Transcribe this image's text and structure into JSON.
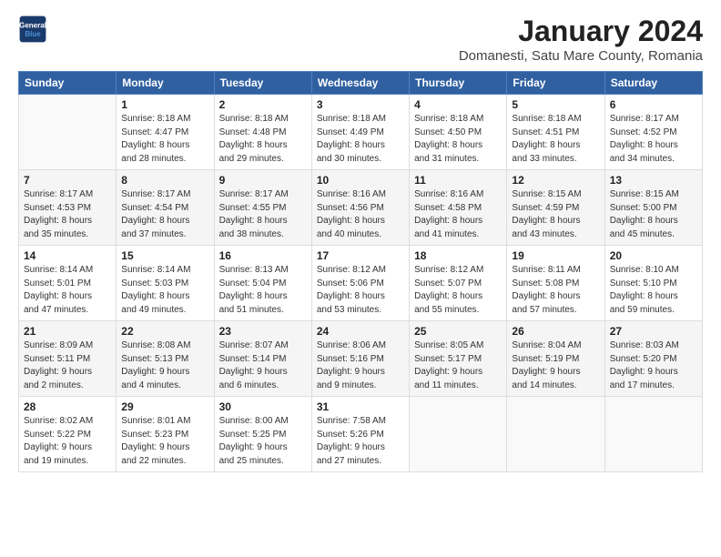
{
  "logo": {
    "line1": "General",
    "line2": "Blue"
  },
  "title": "January 2024",
  "subtitle": "Domanesti, Satu Mare County, Romania",
  "days_of_week": [
    "Sunday",
    "Monday",
    "Tuesday",
    "Wednesday",
    "Thursday",
    "Friday",
    "Saturday"
  ],
  "weeks": [
    [
      {
        "day": "",
        "info": ""
      },
      {
        "day": "1",
        "info": "Sunrise: 8:18 AM\nSunset: 4:47 PM\nDaylight: 8 hours\nand 28 minutes."
      },
      {
        "day": "2",
        "info": "Sunrise: 8:18 AM\nSunset: 4:48 PM\nDaylight: 8 hours\nand 29 minutes."
      },
      {
        "day": "3",
        "info": "Sunrise: 8:18 AM\nSunset: 4:49 PM\nDaylight: 8 hours\nand 30 minutes."
      },
      {
        "day": "4",
        "info": "Sunrise: 8:18 AM\nSunset: 4:50 PM\nDaylight: 8 hours\nand 31 minutes."
      },
      {
        "day": "5",
        "info": "Sunrise: 8:18 AM\nSunset: 4:51 PM\nDaylight: 8 hours\nand 33 minutes."
      },
      {
        "day": "6",
        "info": "Sunrise: 8:17 AM\nSunset: 4:52 PM\nDaylight: 8 hours\nand 34 minutes."
      }
    ],
    [
      {
        "day": "7",
        "info": "Sunrise: 8:17 AM\nSunset: 4:53 PM\nDaylight: 8 hours\nand 35 minutes."
      },
      {
        "day": "8",
        "info": "Sunrise: 8:17 AM\nSunset: 4:54 PM\nDaylight: 8 hours\nand 37 minutes."
      },
      {
        "day": "9",
        "info": "Sunrise: 8:17 AM\nSunset: 4:55 PM\nDaylight: 8 hours\nand 38 minutes."
      },
      {
        "day": "10",
        "info": "Sunrise: 8:16 AM\nSunset: 4:56 PM\nDaylight: 8 hours\nand 40 minutes."
      },
      {
        "day": "11",
        "info": "Sunrise: 8:16 AM\nSunset: 4:58 PM\nDaylight: 8 hours\nand 41 minutes."
      },
      {
        "day": "12",
        "info": "Sunrise: 8:15 AM\nSunset: 4:59 PM\nDaylight: 8 hours\nand 43 minutes."
      },
      {
        "day": "13",
        "info": "Sunrise: 8:15 AM\nSunset: 5:00 PM\nDaylight: 8 hours\nand 45 minutes."
      }
    ],
    [
      {
        "day": "14",
        "info": "Sunrise: 8:14 AM\nSunset: 5:01 PM\nDaylight: 8 hours\nand 47 minutes."
      },
      {
        "day": "15",
        "info": "Sunrise: 8:14 AM\nSunset: 5:03 PM\nDaylight: 8 hours\nand 49 minutes."
      },
      {
        "day": "16",
        "info": "Sunrise: 8:13 AM\nSunset: 5:04 PM\nDaylight: 8 hours\nand 51 minutes."
      },
      {
        "day": "17",
        "info": "Sunrise: 8:12 AM\nSunset: 5:06 PM\nDaylight: 8 hours\nand 53 minutes."
      },
      {
        "day": "18",
        "info": "Sunrise: 8:12 AM\nSunset: 5:07 PM\nDaylight: 8 hours\nand 55 minutes."
      },
      {
        "day": "19",
        "info": "Sunrise: 8:11 AM\nSunset: 5:08 PM\nDaylight: 8 hours\nand 57 minutes."
      },
      {
        "day": "20",
        "info": "Sunrise: 8:10 AM\nSunset: 5:10 PM\nDaylight: 8 hours\nand 59 minutes."
      }
    ],
    [
      {
        "day": "21",
        "info": "Sunrise: 8:09 AM\nSunset: 5:11 PM\nDaylight: 9 hours\nand 2 minutes."
      },
      {
        "day": "22",
        "info": "Sunrise: 8:08 AM\nSunset: 5:13 PM\nDaylight: 9 hours\nand 4 minutes."
      },
      {
        "day": "23",
        "info": "Sunrise: 8:07 AM\nSunset: 5:14 PM\nDaylight: 9 hours\nand 6 minutes."
      },
      {
        "day": "24",
        "info": "Sunrise: 8:06 AM\nSunset: 5:16 PM\nDaylight: 9 hours\nand 9 minutes."
      },
      {
        "day": "25",
        "info": "Sunrise: 8:05 AM\nSunset: 5:17 PM\nDaylight: 9 hours\nand 11 minutes."
      },
      {
        "day": "26",
        "info": "Sunrise: 8:04 AM\nSunset: 5:19 PM\nDaylight: 9 hours\nand 14 minutes."
      },
      {
        "day": "27",
        "info": "Sunrise: 8:03 AM\nSunset: 5:20 PM\nDaylight: 9 hours\nand 17 minutes."
      }
    ],
    [
      {
        "day": "28",
        "info": "Sunrise: 8:02 AM\nSunset: 5:22 PM\nDaylight: 9 hours\nand 19 minutes."
      },
      {
        "day": "29",
        "info": "Sunrise: 8:01 AM\nSunset: 5:23 PM\nDaylight: 9 hours\nand 22 minutes."
      },
      {
        "day": "30",
        "info": "Sunrise: 8:00 AM\nSunset: 5:25 PM\nDaylight: 9 hours\nand 25 minutes."
      },
      {
        "day": "31",
        "info": "Sunrise: 7:58 AM\nSunset: 5:26 PM\nDaylight: 9 hours\nand 27 minutes."
      },
      {
        "day": "",
        "info": ""
      },
      {
        "day": "",
        "info": ""
      },
      {
        "day": "",
        "info": ""
      }
    ]
  ]
}
